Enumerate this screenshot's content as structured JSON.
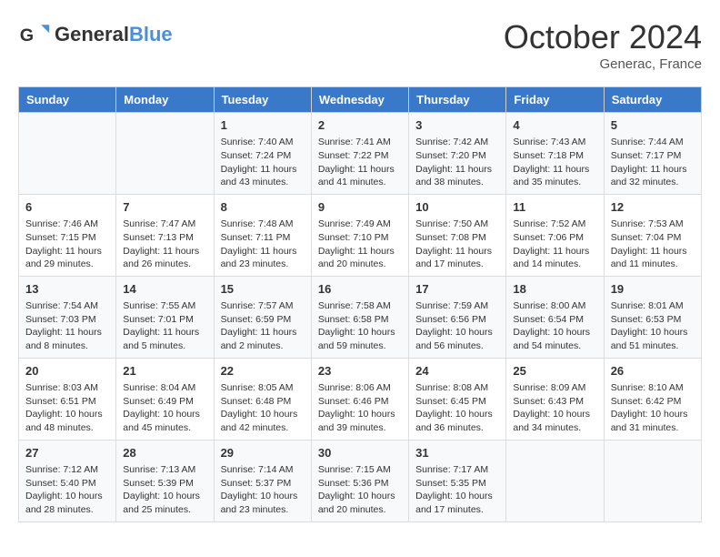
{
  "header": {
    "logo_line1": "General",
    "logo_line2": "Blue",
    "month": "October 2024",
    "location": "Generac, France"
  },
  "weekdays": [
    "Sunday",
    "Monday",
    "Tuesday",
    "Wednesday",
    "Thursday",
    "Friday",
    "Saturday"
  ],
  "weeks": [
    [
      {
        "day": "",
        "info": ""
      },
      {
        "day": "",
        "info": ""
      },
      {
        "day": "1",
        "info": "Sunrise: 7:40 AM\nSunset: 7:24 PM\nDaylight: 11 hours and 43 minutes."
      },
      {
        "day": "2",
        "info": "Sunrise: 7:41 AM\nSunset: 7:22 PM\nDaylight: 11 hours and 41 minutes."
      },
      {
        "day": "3",
        "info": "Sunrise: 7:42 AM\nSunset: 7:20 PM\nDaylight: 11 hours and 38 minutes."
      },
      {
        "day": "4",
        "info": "Sunrise: 7:43 AM\nSunset: 7:18 PM\nDaylight: 11 hours and 35 minutes."
      },
      {
        "day": "5",
        "info": "Sunrise: 7:44 AM\nSunset: 7:17 PM\nDaylight: 11 hours and 32 minutes."
      }
    ],
    [
      {
        "day": "6",
        "info": "Sunrise: 7:46 AM\nSunset: 7:15 PM\nDaylight: 11 hours and 29 minutes."
      },
      {
        "day": "7",
        "info": "Sunrise: 7:47 AM\nSunset: 7:13 PM\nDaylight: 11 hours and 26 minutes."
      },
      {
        "day": "8",
        "info": "Sunrise: 7:48 AM\nSunset: 7:11 PM\nDaylight: 11 hours and 23 minutes."
      },
      {
        "day": "9",
        "info": "Sunrise: 7:49 AM\nSunset: 7:10 PM\nDaylight: 11 hours and 20 minutes."
      },
      {
        "day": "10",
        "info": "Sunrise: 7:50 AM\nSunset: 7:08 PM\nDaylight: 11 hours and 17 minutes."
      },
      {
        "day": "11",
        "info": "Sunrise: 7:52 AM\nSunset: 7:06 PM\nDaylight: 11 hours and 14 minutes."
      },
      {
        "day": "12",
        "info": "Sunrise: 7:53 AM\nSunset: 7:04 PM\nDaylight: 11 hours and 11 minutes."
      }
    ],
    [
      {
        "day": "13",
        "info": "Sunrise: 7:54 AM\nSunset: 7:03 PM\nDaylight: 11 hours and 8 minutes."
      },
      {
        "day": "14",
        "info": "Sunrise: 7:55 AM\nSunset: 7:01 PM\nDaylight: 11 hours and 5 minutes."
      },
      {
        "day": "15",
        "info": "Sunrise: 7:57 AM\nSunset: 6:59 PM\nDaylight: 11 hours and 2 minutes."
      },
      {
        "day": "16",
        "info": "Sunrise: 7:58 AM\nSunset: 6:58 PM\nDaylight: 10 hours and 59 minutes."
      },
      {
        "day": "17",
        "info": "Sunrise: 7:59 AM\nSunset: 6:56 PM\nDaylight: 10 hours and 56 minutes."
      },
      {
        "day": "18",
        "info": "Sunrise: 8:00 AM\nSunset: 6:54 PM\nDaylight: 10 hours and 54 minutes."
      },
      {
        "day": "19",
        "info": "Sunrise: 8:01 AM\nSunset: 6:53 PM\nDaylight: 10 hours and 51 minutes."
      }
    ],
    [
      {
        "day": "20",
        "info": "Sunrise: 8:03 AM\nSunset: 6:51 PM\nDaylight: 10 hours and 48 minutes."
      },
      {
        "day": "21",
        "info": "Sunrise: 8:04 AM\nSunset: 6:49 PM\nDaylight: 10 hours and 45 minutes."
      },
      {
        "day": "22",
        "info": "Sunrise: 8:05 AM\nSunset: 6:48 PM\nDaylight: 10 hours and 42 minutes."
      },
      {
        "day": "23",
        "info": "Sunrise: 8:06 AM\nSunset: 6:46 PM\nDaylight: 10 hours and 39 minutes."
      },
      {
        "day": "24",
        "info": "Sunrise: 8:08 AM\nSunset: 6:45 PM\nDaylight: 10 hours and 36 minutes."
      },
      {
        "day": "25",
        "info": "Sunrise: 8:09 AM\nSunset: 6:43 PM\nDaylight: 10 hours and 34 minutes."
      },
      {
        "day": "26",
        "info": "Sunrise: 8:10 AM\nSunset: 6:42 PM\nDaylight: 10 hours and 31 minutes."
      }
    ],
    [
      {
        "day": "27",
        "info": "Sunrise: 7:12 AM\nSunset: 5:40 PM\nDaylight: 10 hours and 28 minutes."
      },
      {
        "day": "28",
        "info": "Sunrise: 7:13 AM\nSunset: 5:39 PM\nDaylight: 10 hours and 25 minutes."
      },
      {
        "day": "29",
        "info": "Sunrise: 7:14 AM\nSunset: 5:37 PM\nDaylight: 10 hours and 23 minutes."
      },
      {
        "day": "30",
        "info": "Sunrise: 7:15 AM\nSunset: 5:36 PM\nDaylight: 10 hours and 20 minutes."
      },
      {
        "day": "31",
        "info": "Sunrise: 7:17 AM\nSunset: 5:35 PM\nDaylight: 10 hours and 17 minutes."
      },
      {
        "day": "",
        "info": ""
      },
      {
        "day": "",
        "info": ""
      }
    ]
  ]
}
